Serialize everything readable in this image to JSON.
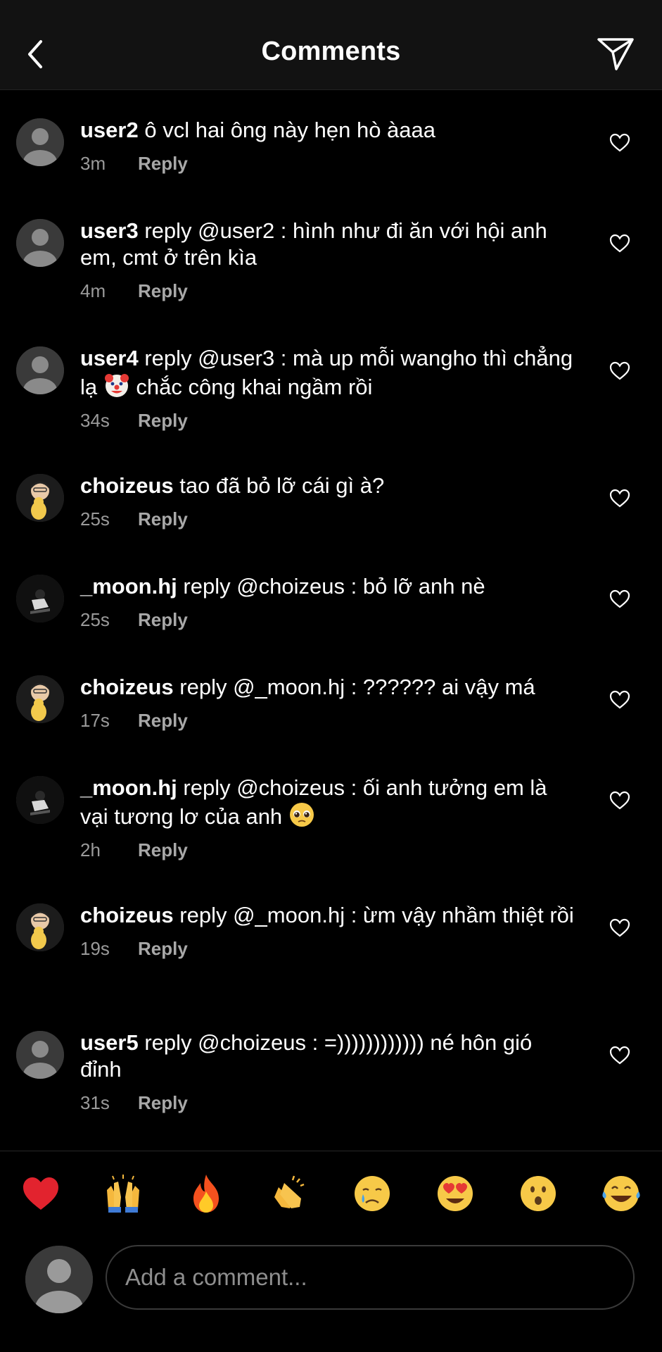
{
  "header": {
    "title": "Comments"
  },
  "comments": [
    {
      "username": "user2",
      "text": "ô vcl hai ông này hẹn hò àaaa",
      "time": "3m",
      "reply_label": "Reply",
      "avatar": "default"
    },
    {
      "username": "user3",
      "text": "reply @user2 : hình như đi ăn với hội anh em, cmt ở trên kìa",
      "time": "4m",
      "reply_label": "Reply",
      "avatar": "default"
    },
    {
      "username": "user4",
      "text_before": "reply @user3 : mà up mỗi wangho thì chẳng lạ",
      "emoji": "clown-face",
      "text_after": "chắc công khai ngầm rồi",
      "time": "34s",
      "reply_label": "Reply",
      "avatar": "default"
    },
    {
      "username": "choizeus",
      "text": "tao đã bỏ lỡ cái gì à?",
      "time": "25s",
      "reply_label": "Reply",
      "avatar": "photo-choizeus"
    },
    {
      "username": "_moon.hj",
      "text": "reply @choizeus : bỏ lỡ anh nè",
      "time": "25s",
      "reply_label": "Reply",
      "avatar": "photo-moon"
    },
    {
      "username": "choizeus",
      "text": "reply @_moon.hj : ?????? ai vậy má",
      "time": "17s",
      "reply_label": "Reply",
      "avatar": "photo-choizeus"
    },
    {
      "username": "_moon.hj",
      "text_before": "reply @choizeus : ối anh tưởng em là vại tương lơ của anh",
      "emoji": "pleading-face",
      "text_after": "",
      "time": "2h",
      "reply_label": "Reply",
      "avatar": "photo-moon"
    },
    {
      "username": "choizeus",
      "text": "reply @_moon.hj : ừm vậy nhầm thiệt rồi",
      "time": "19s",
      "reply_label": "Reply",
      "avatar": "photo-choizeus"
    },
    {
      "username": "user5",
      "text": "reply @choizeus : =)))))))))))) né hôn gió đỉnh",
      "time": "31s",
      "reply_label": "Reply",
      "avatar": "default"
    }
  ],
  "reactions": [
    "red-heart",
    "raising-hands",
    "fire",
    "clapping-hands",
    "crying-face",
    "heart-eyes",
    "surprised-face",
    "tears-of-joy"
  ],
  "composer": {
    "placeholder": "Add a comment..."
  },
  "colors": {
    "background": "#000000",
    "header_bg": "#121212",
    "secondary_text": "#9a9a9a",
    "heart_outline": "#ffffff"
  }
}
